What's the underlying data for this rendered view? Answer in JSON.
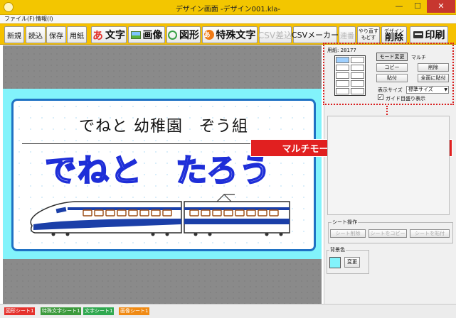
{
  "window": {
    "title": "デザイン画面 -デザイン001.kla-",
    "minimize": "—",
    "maximize": "☐",
    "close": "✕"
  },
  "menu": {
    "items": [
      {
        "label": "ファイル(F)"
      },
      {
        "label": "情報(I)"
      }
    ]
  },
  "toolbar": {
    "new": "新規",
    "open": "読込",
    "save": "保存",
    "paper": "用紙",
    "text": "文字",
    "text_icon": "あ",
    "image": "画像",
    "shape": "図形",
    "special_text": "特殊文字",
    "special_icon": "あ",
    "csv_insert": "CSV差込",
    "csv_maker": "CSVメーカー",
    "continuous": "連番",
    "redo": "やり直す",
    "undo": "もどす",
    "design_label": "デザイン",
    "delete": "削除",
    "print": "印刷"
  },
  "canvas": {
    "line1": "でねと 幼稚園　ぞう組",
    "name": "でねと　たろう",
    "background_color": "#82f3fb",
    "border_color": "#1f72c4"
  },
  "panel": {
    "paper_label": "用紙: 28177",
    "mode_toggle": "モード変更",
    "mode_name": "マルチ",
    "copy": "コピー",
    "delete": "削除",
    "paste": "貼付",
    "paste_all": "全面に貼付",
    "display_size_label": "表示サイズ",
    "display_size_value": "標準サイズ",
    "guide_checkbox_label": "ガイド目盛り表示",
    "guide_checked": "✓",
    "sheet_ops_legend": "シート操作",
    "sheet_delete": "シート削除",
    "sheet_copy": "シートをコピー",
    "sheet_paste": "シートを貼付",
    "bg_legend": "背景色",
    "bg_change": "変更",
    "bg_swatch_color": "#82f3fb"
  },
  "callout": {
    "text": "マルチモードに切り替わりました"
  },
  "status_tabs": [
    {
      "label": "図形シート1",
      "color": "#e5322d"
    },
    {
      "label": "特殊文字シート1",
      "color": "#3c9a3c"
    },
    {
      "label": "文字シート1",
      "color": "#2fa84f"
    },
    {
      "label": "画像シート1",
      "color": "#f08a14"
    }
  ]
}
